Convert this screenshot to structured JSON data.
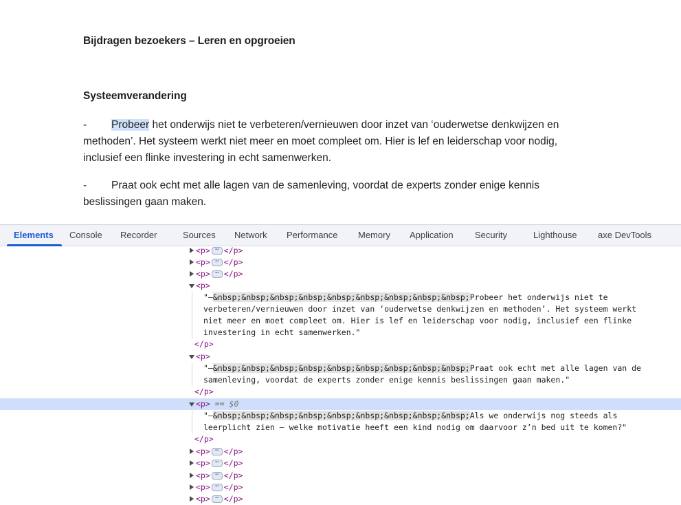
{
  "document": {
    "heading": "Bijdragen bezoekers – Leren en opgroeien",
    "subheading": "Systeemverandering",
    "paragraphs": [
      {
        "dash": "-",
        "highlighted_word": "Probeer",
        "line1_rest": " het onderwijs niet te verbeteren/vernieuwen door inzet van ‘ouderwetse denkwijzen en",
        "line2": "methoden’. Het systeem werkt niet meer en moet compleet om. Hier is lef en leiderschap voor nodig,",
        "line3": "inclusief een flinke investering in echt samenwerken."
      },
      {
        "dash": "-",
        "line1": "Praat ook echt met alle lagen van de samenleving, voordat de experts zonder enige kennis",
        "line2": "beslissingen gaan maken."
      }
    ]
  },
  "devtools": {
    "tabs": [
      "Elements",
      "Console",
      "Recorder",
      "Sources",
      "Network",
      "Performance",
      "Memory",
      "Application",
      "Security",
      "Lighthouse",
      "axe DevTools"
    ],
    "active_tab": "Elements",
    "tree": {
      "open_tag": "<p>",
      "close_tag": "</p>",
      "ellipsis": "⋯",
      "dash_prefix": "\"–",
      "nbsp_run": "&nbsp;&nbsp;&nbsp;&nbsp;&nbsp;&nbsp;&nbsp;&nbsp;&nbsp;",
      "selected_marker": "==",
      "selected_var": "$0",
      "node1": {
        "line1": "Probeer het onderwijs niet te",
        "line2": "verbeteren/vernieuwen door inzet van ‘ouderwetse denkwijzen en methoden’. Het systeem werkt",
        "line3": "niet meer en moet compleet om. Hier is lef en leiderschap voor nodig, inclusief een flinke",
        "line4": "investering in echt samenwerken.\""
      },
      "node2": {
        "line1": "Praat ook echt met alle lagen van de",
        "line2": "samenleving, voordat de experts zonder enige kennis beslissingen gaan maken.\""
      },
      "node3": {
        "line1": "Als we onderwijs nog steeds als",
        "line2": "leerplicht zien – welke motivatie heeft een kind nodig om daarvoor z’n bed uit te komen?\""
      }
    }
  }
}
